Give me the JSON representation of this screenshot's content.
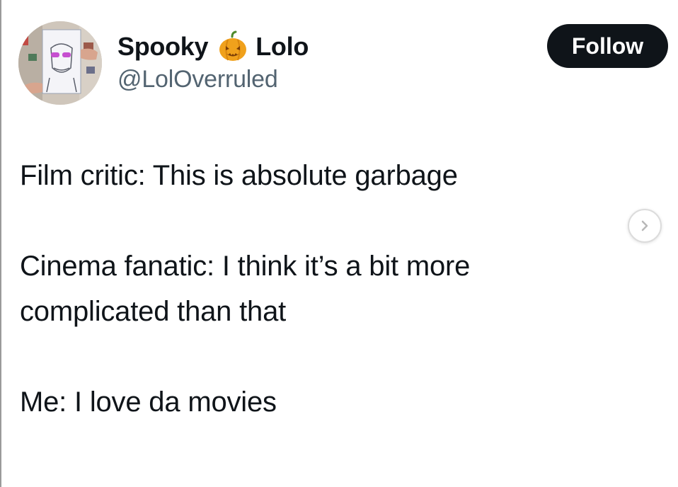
{
  "author": {
    "name_first": "Spooky",
    "name_emoji": "pumpkin-emoji",
    "name_last": "Lolo",
    "handle": "@LolOverruled"
  },
  "follow_label": "Follow",
  "tweet": {
    "lines": [
      "Film critic: This is absolute garbage",
      "",
      "Cinema fanatic: I think it’s a bit more",
      "complicated than that",
      "",
      "Me: I love da movies"
    ]
  },
  "icons": {
    "next": "chevron-right-icon",
    "emoji": "pumpkin-icon"
  },
  "colors": {
    "text": "#0f1419",
    "handle": "#536471",
    "button_bg": "#0f1419",
    "button_text": "#ffffff",
    "pumpkin": "#f0a11c"
  }
}
